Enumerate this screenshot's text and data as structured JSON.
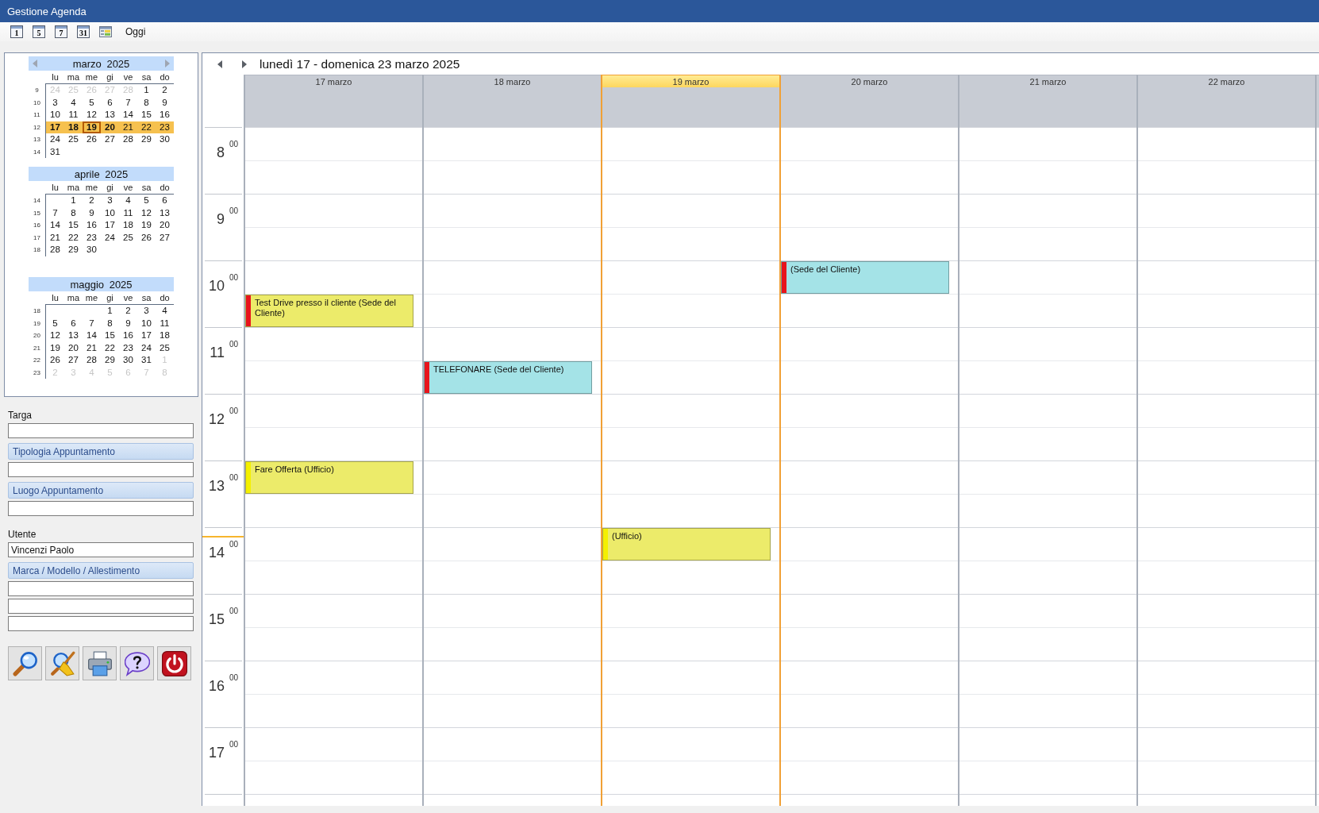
{
  "window": {
    "title": "Gestione Agenda"
  },
  "toolbar": [
    {
      "kind": "calendar",
      "label": "1"
    },
    {
      "kind": "calendar",
      "label": "5"
    },
    {
      "kind": "calendar",
      "label": "7"
    },
    {
      "kind": "calendar",
      "label": "31"
    },
    {
      "kind": "schedule"
    },
    {
      "kind": "text",
      "label": "Oggi"
    }
  ],
  "mini_calendar": {
    "months": [
      {
        "title": "marzo 2025",
        "navigation": true,
        "weekdays": [
          "lu",
          "ma",
          "me",
          "gi",
          "ve",
          "sa",
          "do"
        ],
        "weeks": [
          {
            "number": "9",
            "selected": false,
            "days": [
              {
                "kind": "day",
                "label": "24",
                "muted": true,
                "bold": false,
                "today": false
              },
              {
                "kind": "day",
                "label": "25",
                "muted": true,
                "bold": false,
                "today": false
              },
              {
                "kind": "day",
                "label": "26",
                "muted": true,
                "bold": false,
                "today": false
              },
              {
                "kind": "day",
                "label": "27",
                "muted": true,
                "bold": false,
                "today": false
              },
              {
                "kind": "day",
                "label": "28",
                "muted": true,
                "bold": false,
                "today": false
              },
              {
                "kind": "day",
                "label": "1",
                "muted": false,
                "bold": false,
                "today": false
              },
              {
                "kind": "day",
                "label": "2",
                "muted": false,
                "bold": false,
                "today": false
              }
            ]
          },
          {
            "number": "10",
            "selected": false,
            "days": [
              {
                "kind": "day",
                "label": "3",
                "muted": false,
                "bold": false,
                "today": false
              },
              {
                "kind": "day",
                "label": "4",
                "muted": false,
                "bold": false,
                "today": false
              },
              {
                "kind": "day",
                "label": "5",
                "muted": false,
                "bold": false,
                "today": false
              },
              {
                "kind": "day",
                "label": "6",
                "muted": false,
                "bold": false,
                "today": false
              },
              {
                "kind": "day",
                "label": "7",
                "muted": false,
                "bold": false,
                "today": false
              },
              {
                "kind": "day",
                "label": "8",
                "muted": false,
                "bold": false,
                "today": false
              },
              {
                "kind": "day",
                "label": "9",
                "muted": false,
                "bold": false,
                "today": false
              }
            ]
          },
          {
            "number": "11",
            "selected": false,
            "days": [
              {
                "kind": "day",
                "label": "10",
                "muted": false,
                "bold": false,
                "today": false
              },
              {
                "kind": "day",
                "label": "11",
                "muted": false,
                "bold": false,
                "today": false
              },
              {
                "kind": "day",
                "label": "12",
                "muted": false,
                "bold": false,
                "today": false
              },
              {
                "kind": "day",
                "label": "13",
                "muted": false,
                "bold": false,
                "today": false
              },
              {
                "kind": "day",
                "label": "14",
                "muted": false,
                "bold": false,
                "today": false
              },
              {
                "kind": "day",
                "label": "15",
                "muted": false,
                "bold": false,
                "today": false
              },
              {
                "kind": "day",
                "label": "16",
                "muted": false,
                "bold": false,
                "today": false
              }
            ]
          },
          {
            "number": "12",
            "selected": true,
            "days": [
              {
                "kind": "day",
                "label": "17",
                "muted": false,
                "bold": true,
                "today": false
              },
              {
                "kind": "day",
                "label": "18",
                "muted": false,
                "bold": true,
                "today": false
              },
              {
                "kind": "day",
                "label": "19",
                "muted": false,
                "bold": true,
                "today": true
              },
              {
                "kind": "day",
                "label": "20",
                "muted": false,
                "bold": true,
                "today": false
              },
              {
                "kind": "day",
                "label": "21",
                "muted": false,
                "bold": false,
                "today": false
              },
              {
                "kind": "day",
                "label": "22",
                "muted": false,
                "bold": false,
                "today": false
              },
              {
                "kind": "day",
                "label": "23",
                "muted": false,
                "bold": false,
                "today": false
              }
            ]
          },
          {
            "number": "13",
            "selected": false,
            "days": [
              {
                "kind": "day",
                "label": "24",
                "muted": false,
                "bold": false,
                "today": false
              },
              {
                "kind": "day",
                "label": "25",
                "muted": false,
                "bold": false,
                "today": false
              },
              {
                "kind": "day",
                "label": "26",
                "muted": false,
                "bold": false,
                "today": false
              },
              {
                "kind": "day",
                "label": "27",
                "muted": false,
                "bold": false,
                "today": false
              },
              {
                "kind": "day",
                "label": "28",
                "muted": false,
                "bold": false,
                "today": false
              },
              {
                "kind": "day",
                "label": "29",
                "muted": false,
                "bold": false,
                "today": false
              },
              {
                "kind": "day",
                "label": "30",
                "muted": false,
                "bold": false,
                "today": false
              }
            ]
          },
          {
            "number": "14",
            "selected": false,
            "days": [
              {
                "kind": "day",
                "label": "31",
                "muted": false,
                "bold": false,
                "today": false
              }
            ]
          }
        ]
      },
      {
        "title": "aprile 2025",
        "navigation": false,
        "weekdays": [
          "lu",
          "ma",
          "me",
          "gi",
          "ve",
          "sa",
          "do"
        ],
        "weeks": [
          {
            "number": "14",
            "selected": false,
            "days": [
              {
                "kind": "blank"
              },
              {
                "kind": "day",
                "label": "1",
                "muted": false,
                "bold": false,
                "today": false
              },
              {
                "kind": "day",
                "label": "2",
                "muted": false,
                "bold": false,
                "today": false
              },
              {
                "kind": "day",
                "label": "3",
                "muted": false,
                "bold": false,
                "today": false
              },
              {
                "kind": "day",
                "label": "4",
                "muted": false,
                "bold": false,
                "today": false
              },
              {
                "kind": "day",
                "label": "5",
                "muted": false,
                "bold": false,
                "today": false
              },
              {
                "kind": "day",
                "label": "6",
                "muted": false,
                "bold": false,
                "today": false
              }
            ]
          },
          {
            "number": "15",
            "selected": false,
            "days": [
              {
                "kind": "day",
                "label": "7",
                "muted": false,
                "bold": false,
                "today": false
              },
              {
                "kind": "day",
                "label": "8",
                "muted": false,
                "bold": false,
                "today": false
              },
              {
                "kind": "day",
                "label": "9",
                "muted": false,
                "bold": false,
                "today": false
              },
              {
                "kind": "day",
                "label": "10",
                "muted": false,
                "bold": false,
                "today": false
              },
              {
                "kind": "day",
                "label": "11",
                "muted": false,
                "bold": false,
                "today": false
              },
              {
                "kind": "day",
                "label": "12",
                "muted": false,
                "bold": false,
                "today": false
              },
              {
                "kind": "day",
                "label": "13",
                "muted": false,
                "bold": false,
                "today": false
              }
            ]
          },
          {
            "number": "16",
            "selected": false,
            "days": [
              {
                "kind": "day",
                "label": "14",
                "muted": false,
                "bold": false,
                "today": false
              },
              {
                "kind": "day",
                "label": "15",
                "muted": false,
                "bold": false,
                "today": false
              },
              {
                "kind": "day",
                "label": "16",
                "muted": false,
                "bold": false,
                "today": false
              },
              {
                "kind": "day",
                "label": "17",
                "muted": false,
                "bold": false,
                "today": false
              },
              {
                "kind": "day",
                "label": "18",
                "muted": false,
                "bold": false,
                "today": false
              },
              {
                "kind": "day",
                "label": "19",
                "muted": false,
                "bold": false,
                "today": false
              },
              {
                "kind": "day",
                "label": "20",
                "muted": false,
                "bold": false,
                "today": false
              }
            ]
          },
          {
            "number": "17",
            "selected": false,
            "days": [
              {
                "kind": "day",
                "label": "21",
                "muted": false,
                "bold": false,
                "today": false
              },
              {
                "kind": "day",
                "label": "22",
                "muted": false,
                "bold": false,
                "today": false
              },
              {
                "kind": "day",
                "label": "23",
                "muted": false,
                "bold": false,
                "today": false
              },
              {
                "kind": "day",
                "label": "24",
                "muted": false,
                "bold": false,
                "today": false
              },
              {
                "kind": "day",
                "label": "25",
                "muted": false,
                "bold": false,
                "today": false
              },
              {
                "kind": "day",
                "label": "26",
                "muted": false,
                "bold": false,
                "today": false
              },
              {
                "kind": "day",
                "label": "27",
                "muted": false,
                "bold": false,
                "today": false
              }
            ]
          },
          {
            "number": "18",
            "selected": false,
            "days": [
              {
                "kind": "day",
                "label": "28",
                "muted": false,
                "bold": false,
                "today": false
              },
              {
                "kind": "day",
                "label": "29",
                "muted": false,
                "bold": false,
                "today": false
              },
              {
                "kind": "day",
                "label": "30",
                "muted": false,
                "bold": false,
                "today": false
              }
            ]
          }
        ]
      },
      {
        "title": "maggio 2025",
        "navigation": false,
        "weekdays": [
          "lu",
          "ma",
          "me",
          "gi",
          "ve",
          "sa",
          "do"
        ],
        "weeks": [
          {
            "number": "18",
            "selected": false,
            "days": [
              {
                "kind": "blank"
              },
              {
                "kind": "blank"
              },
              {
                "kind": "blank"
              },
              {
                "kind": "day",
                "label": "1",
                "muted": false,
                "bold": false,
                "today": false
              },
              {
                "kind": "day",
                "label": "2",
                "muted": false,
                "bold": false,
                "today": false
              },
              {
                "kind": "day",
                "label": "3",
                "muted": false,
                "bold": false,
                "today": false
              },
              {
                "kind": "day",
                "label": "4",
                "muted": false,
                "bold": false,
                "today": false
              }
            ]
          },
          {
            "number": "19",
            "selected": false,
            "days": [
              {
                "kind": "day",
                "label": "5",
                "muted": false,
                "bold": false,
                "today": false
              },
              {
                "kind": "day",
                "label": "6",
                "muted": false,
                "bold": false,
                "today": false
              },
              {
                "kind": "day",
                "label": "7",
                "muted": false,
                "bold": false,
                "today": false
              },
              {
                "kind": "day",
                "label": "8",
                "muted": false,
                "bold": false,
                "today": false
              },
              {
                "kind": "day",
                "label": "9",
                "muted": false,
                "bold": false,
                "today": false
              },
              {
                "kind": "day",
                "label": "10",
                "muted": false,
                "bold": false,
                "today": false
              },
              {
                "kind": "day",
                "label": "11",
                "muted": false,
                "bold": false,
                "today": false
              }
            ]
          },
          {
            "number": "20",
            "selected": false,
            "days": [
              {
                "kind": "day",
                "label": "12",
                "muted": false,
                "bold": false,
                "today": false
              },
              {
                "kind": "day",
                "label": "13",
                "muted": false,
                "bold": false,
                "today": false
              },
              {
                "kind": "day",
                "label": "14",
                "muted": false,
                "bold": false,
                "today": false
              },
              {
                "kind": "day",
                "label": "15",
                "muted": false,
                "bold": false,
                "today": false
              },
              {
                "kind": "day",
                "label": "16",
                "muted": false,
                "bold": false,
                "today": false
              },
              {
                "kind": "day",
                "label": "17",
                "muted": false,
                "bold": false,
                "today": false
              },
              {
                "kind": "day",
                "label": "18",
                "muted": false,
                "bold": false,
                "today": false
              }
            ]
          },
          {
            "number": "21",
            "selected": false,
            "days": [
              {
                "kind": "day",
                "label": "19",
                "muted": false,
                "bold": false,
                "today": false
              },
              {
                "kind": "day",
                "label": "20",
                "muted": false,
                "bold": false,
                "today": false
              },
              {
                "kind": "day",
                "label": "21",
                "muted": false,
                "bold": false,
                "today": false
              },
              {
                "kind": "day",
                "label": "22",
                "muted": false,
                "bold": false,
                "today": false
              },
              {
                "kind": "day",
                "label": "23",
                "muted": false,
                "bold": false,
                "today": false
              },
              {
                "kind": "day",
                "label": "24",
                "muted": false,
                "bold": false,
                "today": false
              },
              {
                "kind": "day",
                "label": "25",
                "muted": false,
                "bold": false,
                "today": false
              }
            ]
          },
          {
            "number": "22",
            "selected": false,
            "days": [
              {
                "kind": "day",
                "label": "26",
                "muted": false,
                "bold": false,
                "today": false
              },
              {
                "kind": "day",
                "label": "27",
                "muted": false,
                "bold": false,
                "today": false
              },
              {
                "kind": "day",
                "label": "28",
                "muted": false,
                "bold": false,
                "today": false
              },
              {
                "kind": "day",
                "label": "29",
                "muted": false,
                "bold": false,
                "today": false
              },
              {
                "kind": "day",
                "label": "30",
                "muted": false,
                "bold": false,
                "today": false
              },
              {
                "kind": "day",
                "label": "31",
                "muted": false,
                "bold": false,
                "today": false
              },
              {
                "kind": "day",
                "label": "1",
                "muted": true,
                "bold": false,
                "today": false
              }
            ]
          },
          {
            "number": "23",
            "selected": false,
            "days": [
              {
                "kind": "day",
                "label": "2",
                "muted": true,
                "bold": false,
                "today": false
              },
              {
                "kind": "day",
                "label": "3",
                "muted": true,
                "bold": false,
                "today": false
              },
              {
                "kind": "day",
                "label": "4",
                "muted": true,
                "bold": false,
                "today": false
              },
              {
                "kind": "day",
                "label": "5",
                "muted": true,
                "bold": false,
                "today": false
              },
              {
                "kind": "day",
                "label": "6",
                "muted": true,
                "bold": false,
                "today": false
              },
              {
                "kind": "day",
                "label": "7",
                "muted": true,
                "bold": false,
                "today": false
              },
              {
                "kind": "day",
                "label": "8",
                "muted": true,
                "bold": false,
                "today": false
              }
            ]
          }
        ]
      }
    ]
  },
  "filters": [
    {
      "kind": "label",
      "text": "Targa"
    },
    {
      "kind": "field"
    },
    {
      "kind": "header",
      "text": "Tipologia Appuntamento"
    },
    {
      "kind": "field"
    },
    {
      "kind": "header",
      "text": "Luogo Appuntamento"
    },
    {
      "kind": "field"
    },
    {
      "kind": "label",
      "text": "Utente"
    },
    {
      "kind": "field",
      "value": "Vincenzi Paolo"
    },
    {
      "kind": "header",
      "text": "Marca / Modello / Allestimento"
    },
    {
      "kind": "field"
    },
    {
      "kind": "field"
    },
    {
      "kind": "field"
    }
  ],
  "actions": [
    {
      "kind": "search"
    },
    {
      "kind": "clear"
    },
    {
      "kind": "print"
    },
    {
      "kind": "help"
    },
    {
      "kind": "exit"
    }
  ],
  "scheduler": {
    "title": "lunedì 17 - domenica 23 marzo 2025",
    "days": [
      {
        "label": "17 marzo",
        "today": false
      },
      {
        "label": "18 marzo",
        "today": false
      },
      {
        "label": "19 marzo",
        "today": true
      },
      {
        "label": "20 marzo",
        "today": false
      },
      {
        "label": "21 marzo",
        "today": false
      },
      {
        "label": "22 marzo",
        "today": false
      }
    ],
    "hours": [
      {
        "hour": "8",
        "minutes": "00",
        "now": false,
        "cells": [
          {
            "kind": "free"
          },
          {
            "kind": "free"
          },
          {
            "kind": "free"
          },
          {
            "kind": "free"
          },
          {
            "kind": "free"
          },
          {
            "kind": "free"
          }
        ]
      },
      {
        "hour": "9",
        "minutes": "00",
        "now": false,
        "cells": [
          {
            "kind": "free"
          },
          {
            "kind": "free"
          },
          {
            "kind": "free"
          },
          {
            "kind": "free"
          },
          {
            "kind": "free"
          },
          {
            "kind": "free"
          }
        ]
      },
      {
        "hour": "10",
        "minutes": "00",
        "now": false,
        "cells": [
          {
            "kind": "appointment",
            "text": "Test Drive presso il cliente (Sede del Cliente)",
            "second_half": true,
            "color": "#eceb6a",
            "busy": true
          },
          {
            "kind": "free"
          },
          {
            "kind": "free"
          },
          {
            "kind": "appointment",
            "text": "(Sede del Cliente)",
            "second_half": false,
            "color": "#a4e3e7",
            "busy": true
          },
          {
            "kind": "free"
          },
          {
            "kind": "free"
          }
        ]
      },
      {
        "hour": "11",
        "minutes": "00",
        "now": false,
        "cells": [
          {
            "kind": "free"
          },
          {
            "kind": "appointment",
            "text": "TELEFONARE (Sede del Cliente)",
            "second_half": true,
            "color": "#a4e3e7",
            "busy": true
          },
          {
            "kind": "free"
          },
          {
            "kind": "free"
          },
          {
            "kind": "free"
          },
          {
            "kind": "free"
          }
        ]
      },
      {
        "hour": "12",
        "minutes": "00",
        "now": false,
        "cells": [
          {
            "kind": "free"
          },
          {
            "kind": "free"
          },
          {
            "kind": "free"
          },
          {
            "kind": "free"
          },
          {
            "kind": "free"
          },
          {
            "kind": "free"
          }
        ]
      },
      {
        "hour": "13",
        "minutes": "00",
        "now": false,
        "cells": [
          {
            "kind": "appointment",
            "text": "Fare Offerta (Ufficio)",
            "second_half": false,
            "color": "#eceb6a",
            "busy": false
          },
          {
            "kind": "free"
          },
          {
            "kind": "free"
          },
          {
            "kind": "free"
          },
          {
            "kind": "free"
          },
          {
            "kind": "free"
          }
        ]
      },
      {
        "hour": "14",
        "minutes": "00",
        "now": true,
        "cells": [
          {
            "kind": "free"
          },
          {
            "kind": "free"
          },
          {
            "kind": "appointment",
            "text": "(Ufficio)",
            "second_half": false,
            "color": "#eceb6a",
            "busy": false
          },
          {
            "kind": "free"
          },
          {
            "kind": "free"
          },
          {
            "kind": "free"
          }
        ]
      },
      {
        "hour": "15",
        "minutes": "00",
        "now": false,
        "cells": [
          {
            "kind": "free"
          },
          {
            "kind": "free"
          },
          {
            "kind": "free"
          },
          {
            "kind": "free"
          },
          {
            "kind": "free"
          },
          {
            "kind": "free"
          }
        ]
      },
      {
        "hour": "16",
        "minutes": "00",
        "now": false,
        "cells": [
          {
            "kind": "free"
          },
          {
            "kind": "free"
          },
          {
            "kind": "free"
          },
          {
            "kind": "free"
          },
          {
            "kind": "free"
          },
          {
            "kind": "free"
          }
        ]
      },
      {
        "hour": "17",
        "minutes": "00",
        "now": false,
        "cells": [
          {
            "kind": "free"
          },
          {
            "kind": "free"
          },
          {
            "kind": "free"
          },
          {
            "kind": "free"
          },
          {
            "kind": "free"
          },
          {
            "kind": "free"
          }
        ]
      }
    ]
  }
}
